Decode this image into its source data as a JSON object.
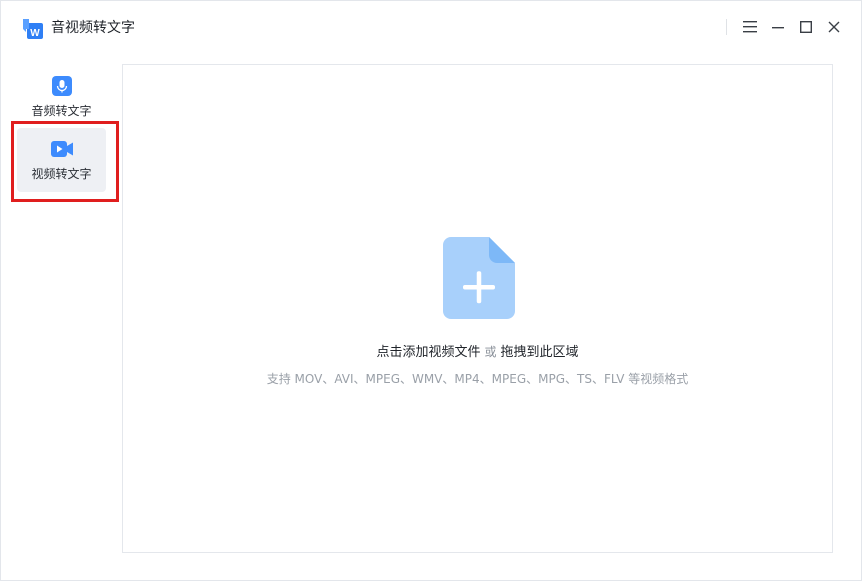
{
  "app": {
    "title": "音视频转文字"
  },
  "window_controls": {
    "menu_icon": "menu-icon",
    "minimize_icon": "minimize-icon",
    "maximize_icon": "maximize-icon",
    "close_icon": "close-icon"
  },
  "sidebar": {
    "items": [
      {
        "label": "音频转文字",
        "icon": "microphone-icon",
        "active": false
      },
      {
        "label": "视频转文字",
        "icon": "video-camera-icon",
        "active": true
      }
    ]
  },
  "dropzone": {
    "icon": "file-add-icon",
    "primary_text": "点击添加视频文件",
    "or_text": "或",
    "drag_text": "拖拽到此区域",
    "formats_text": "支持 MOV、AVI、MPEG、WMV、MP4、MPEG、MPG、TS、FLV 等视频格式"
  },
  "colors": {
    "accent": "#3d8bfd",
    "highlight_border": "#e01e1e",
    "file_icon_body": "#a8d0fb",
    "file_icon_fold": "#7db8f7"
  }
}
